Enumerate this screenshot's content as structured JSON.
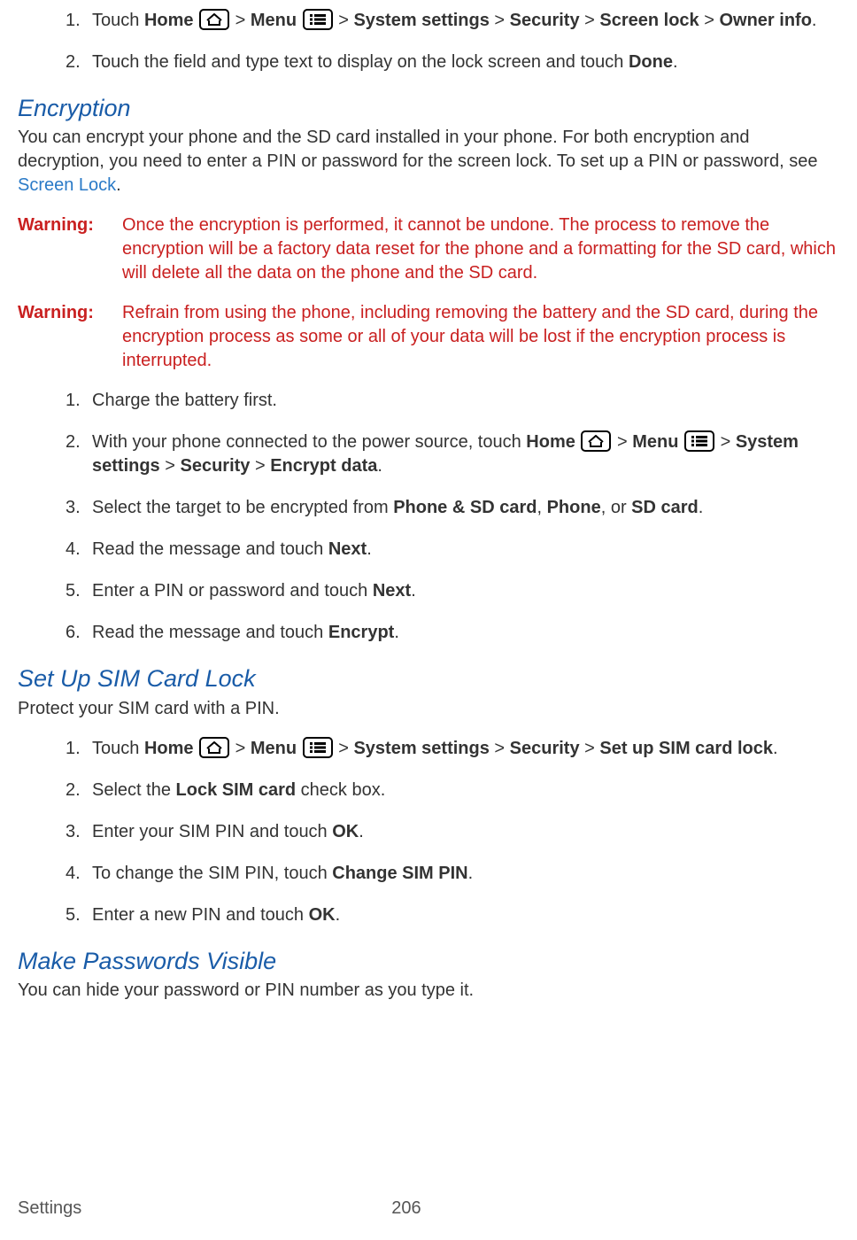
{
  "intro_steps": [
    {
      "num": "1.",
      "segments": [
        {
          "t": "Touch "
        },
        {
          "t": "Home",
          "b": true
        },
        {
          "t": " "
        },
        {
          "icon": "home"
        },
        {
          "t": " > "
        },
        {
          "t": "Menu",
          "b": true
        },
        {
          "t": " "
        },
        {
          "icon": "menu"
        },
        {
          "t": " > "
        },
        {
          "t": "System settings",
          "b": true
        },
        {
          "t": " > "
        },
        {
          "t": "Security",
          "b": true
        },
        {
          "t": " > "
        },
        {
          "t": "Screen lock",
          "b": true
        },
        {
          "t": " > "
        },
        {
          "t": "Owner info",
          "b": true
        },
        {
          "t": "."
        }
      ]
    },
    {
      "num": "2.",
      "segments": [
        {
          "t": "Touch the field and type text to display on the lock screen and touch "
        },
        {
          "t": "Done",
          "b": true
        },
        {
          "t": "."
        }
      ]
    }
  ],
  "encryption": {
    "heading": "Encryption",
    "intro_pre": "You can encrypt your phone and the SD card installed in your phone. For both encryption and decryption, you need to enter a PIN or password for the screen lock. To set up a PIN or password, see ",
    "intro_link": "Screen Lock",
    "intro_post": ".",
    "warnings": [
      {
        "label": "Warning:",
        "body": "Once the encryption is performed, it cannot be undone. The process to remove the encryption will be a factory data reset for the phone and a formatting for the SD card, which will delete all the data on the phone and the SD card."
      },
      {
        "label": "Warning:",
        "body": "Refrain from using the phone, including removing the battery and the SD card, during the encryption process as some or all of your data will be lost if the encryption process is interrupted."
      }
    ],
    "steps": [
      {
        "num": "1.",
        "segments": [
          {
            "t": "Charge the battery first."
          }
        ]
      },
      {
        "num": "2.",
        "segments": [
          {
            "t": "With your phone connected to the power source, touch "
          },
          {
            "t": "Home",
            "b": true
          },
          {
            "t": " "
          },
          {
            "icon": "home"
          },
          {
            "t": " > "
          },
          {
            "t": "Menu",
            "b": true
          },
          {
            "t": " "
          },
          {
            "icon": "menu"
          },
          {
            "t": " > "
          },
          {
            "t": "System settings",
            "b": true
          },
          {
            "t": " > "
          },
          {
            "t": "Security",
            "b": true
          },
          {
            "t": " > "
          },
          {
            "t": "Encrypt data",
            "b": true
          },
          {
            "t": "."
          }
        ]
      },
      {
        "num": "3.",
        "segments": [
          {
            "t": "Select the target to be encrypted from "
          },
          {
            "t": "Phone & SD card",
            "b": true
          },
          {
            "t": ", "
          },
          {
            "t": "Phone",
            "b": true
          },
          {
            "t": ", or "
          },
          {
            "t": "SD card",
            "b": true
          },
          {
            "t": "."
          }
        ]
      },
      {
        "num": "4.",
        "segments": [
          {
            "t": "Read the message and touch "
          },
          {
            "t": "Next",
            "b": true
          },
          {
            "t": "."
          }
        ]
      },
      {
        "num": "5.",
        "segments": [
          {
            "t": "Enter a PIN or password and touch "
          },
          {
            "t": "Next",
            "b": true
          },
          {
            "t": "."
          }
        ]
      },
      {
        "num": "6.",
        "segments": [
          {
            "t": "Read the message and touch "
          },
          {
            "t": "Encrypt",
            "b": true
          },
          {
            "t": "."
          }
        ]
      }
    ]
  },
  "sim": {
    "heading": "Set Up SIM Card Lock",
    "intro": "Protect your SIM card with a PIN.",
    "steps": [
      {
        "num": "1.",
        "segments": [
          {
            "t": "Touch "
          },
          {
            "t": "Home",
            "b": true
          },
          {
            "t": " "
          },
          {
            "icon": "home"
          },
          {
            "t": " > "
          },
          {
            "t": "Menu",
            "b": true
          },
          {
            "t": " "
          },
          {
            "icon": "menu"
          },
          {
            "t": " > "
          },
          {
            "t": "System settings",
            "b": true
          },
          {
            "t": " > "
          },
          {
            "t": "Security",
            "b": true
          },
          {
            "t": " > "
          },
          {
            "t": "Set up SIM card lock",
            "b": true
          },
          {
            "t": "."
          }
        ]
      },
      {
        "num": "2.",
        "segments": [
          {
            "t": "Select the "
          },
          {
            "t": "Lock SIM card",
            "b": true
          },
          {
            "t": " check box."
          }
        ]
      },
      {
        "num": "3.",
        "segments": [
          {
            "t": "Enter your SIM PIN and touch "
          },
          {
            "t": "OK",
            "b": true
          },
          {
            "t": "."
          }
        ]
      },
      {
        "num": "4.",
        "segments": [
          {
            "t": "To change the SIM PIN, touch "
          },
          {
            "t": "Change SIM PIN",
            "b": true
          },
          {
            "t": "."
          }
        ]
      },
      {
        "num": "5.",
        "segments": [
          {
            "t": "Enter a new PIN and touch "
          },
          {
            "t": "OK",
            "b": true
          },
          {
            "t": "."
          }
        ]
      }
    ]
  },
  "passwords": {
    "heading": "Make Passwords Visible",
    "intro": "You can hide your password or PIN number as you type it."
  },
  "footer": {
    "section": "Settings",
    "page": "206"
  }
}
